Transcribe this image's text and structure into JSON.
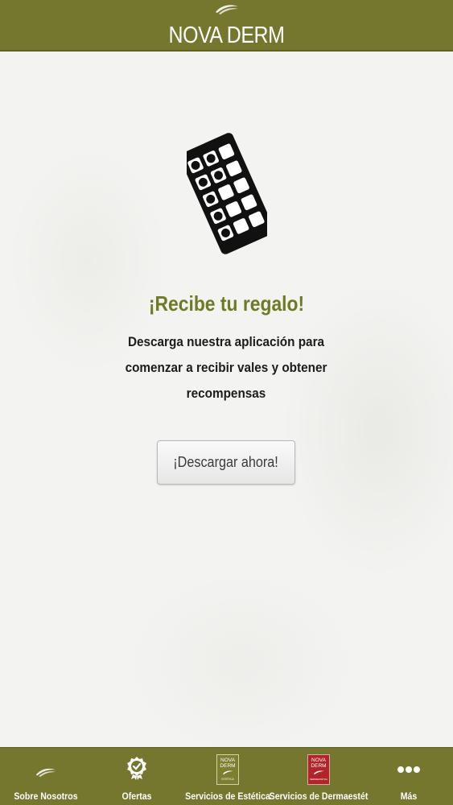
{
  "header": {
    "title": "NOVA DERM",
    "logo_icon": "leaf-swoosh-icon"
  },
  "main": {
    "illustration_icon": "stamp-card-icon",
    "headline": "¡Recibe tu regalo!",
    "description": "Descarga nuestra aplicación para comenzar a recibir vales y obtener recompensas",
    "cta_label": "¡Descargar ahora!"
  },
  "tabbar": {
    "tabs": [
      {
        "label": "Sobre Nosotros",
        "icon": "leaf-swoosh-icon"
      },
      {
        "label": "Ofertas",
        "icon": "badge-check-icon"
      },
      {
        "label": "Servicios de Estética",
        "icon": "nova-derm-estetica-logo"
      },
      {
        "label": "Servicios de Dermaestét",
        "icon": "nova-derm-dermaestetica-logo"
      },
      {
        "label": "Más",
        "icon": "more-dots-icon"
      }
    ],
    "logo_text": {
      "estetica": [
        "NOVA",
        "DERM",
        "ESTÉTICA"
      ],
      "dermaestetica": [
        "NOVA",
        "DERM",
        "DERMAESTÉTICA"
      ]
    }
  },
  "colors": {
    "brand_olive": "#74772d",
    "headline_olive": "#6f7a24",
    "background": "#f3f3f1",
    "logo_red": "#b0242a"
  }
}
